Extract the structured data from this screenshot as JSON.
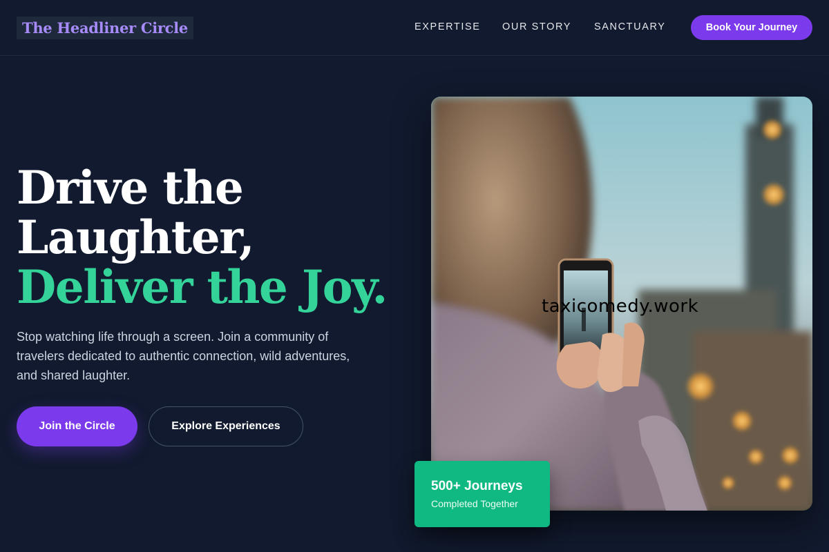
{
  "brand": {
    "name": "The Headliner Circle"
  },
  "nav": {
    "links": [
      "EXPERTISE",
      "OUR STORY",
      "SANCTUARY"
    ],
    "cta_label": "Book Your Journey"
  },
  "hero": {
    "title_line1": "Drive the",
    "title_line2": "Laughter,",
    "title_accent": "Deliver the Joy.",
    "subtitle": "Stop watching life through a screen. Join a community of travelers dedicated to authentic connection, wild adventures, and shared laughter.",
    "primary_cta": "Join the Circle",
    "secondary_cta": "Explore Experiences"
  },
  "image": {
    "subject": "person-photographing-tower-with-phone",
    "watermark": "taxicomedy.work"
  },
  "stat_badge": {
    "title": "500+ Journeys",
    "subtitle": "Completed Together"
  },
  "colors": {
    "background": "#111a2e",
    "accent_purple": "#7c3aed",
    "accent_green": "#34d399",
    "badge_green": "#10b981",
    "logo_text": "#a78bfa"
  }
}
